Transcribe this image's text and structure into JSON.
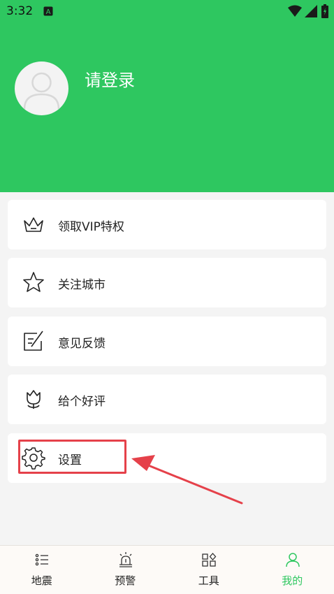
{
  "status_bar": {
    "time": "3:32",
    "icons": [
      "notification-a-icon",
      "wifi-icon",
      "signal-icon",
      "battery-icon"
    ]
  },
  "profile": {
    "login_prompt": "请登录",
    "avatar_icon": "default-user-avatar-icon"
  },
  "menu": [
    {
      "label": "领取VIP特权",
      "icon": "crown-icon"
    },
    {
      "label": "关注城市",
      "icon": "star-icon"
    },
    {
      "label": "意见反馈",
      "icon": "feedback-edit-icon"
    },
    {
      "label": "给个好评",
      "icon": "tulip-icon"
    },
    {
      "label": "设置",
      "icon": "gear-icon"
    }
  ],
  "bottom_nav": [
    {
      "label": "地震",
      "icon": "list-icon",
      "active": false
    },
    {
      "label": "预警",
      "icon": "alarm-light-icon",
      "active": false
    },
    {
      "label": "工具",
      "icon": "grid-tools-icon",
      "active": false
    },
    {
      "label": "我的",
      "icon": "person-icon",
      "active": true
    }
  ],
  "colors": {
    "brand_green": "#2ec760",
    "highlight_red": "#e5414a",
    "background": "#f4f4f4"
  }
}
